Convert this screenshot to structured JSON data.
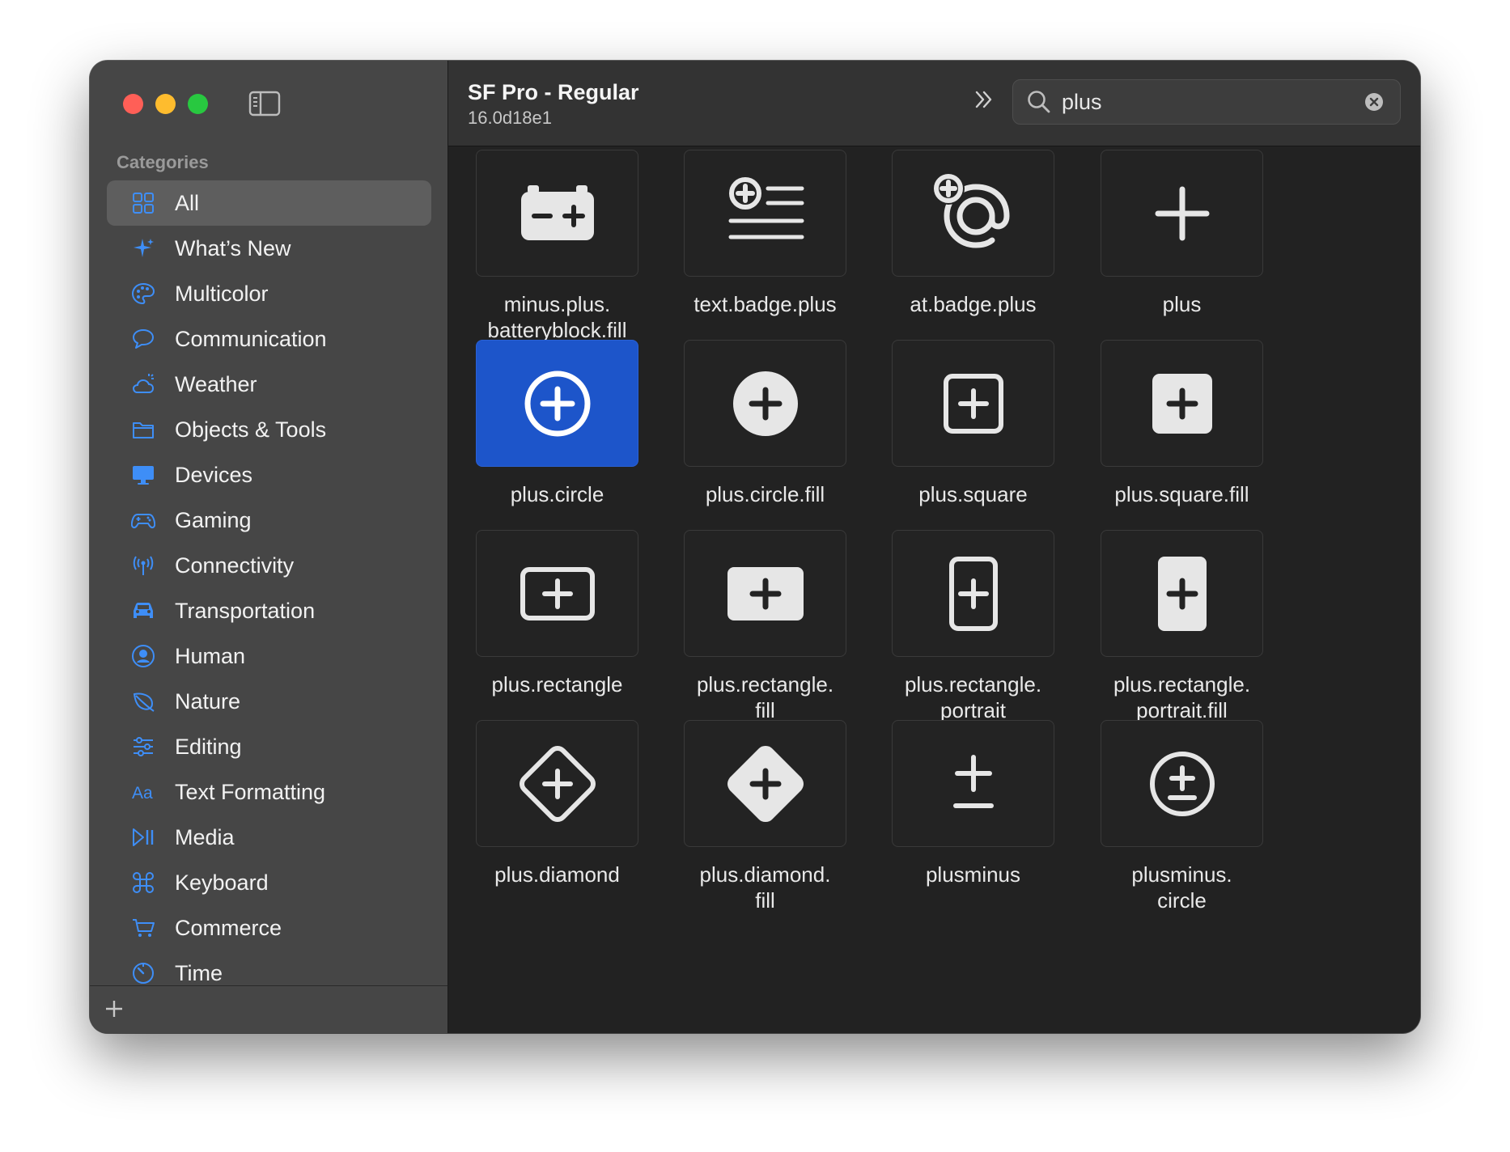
{
  "sidebar": {
    "section_header": "Categories",
    "items": [
      {
        "label": "All",
        "icon": "grid-icon",
        "selected": true
      },
      {
        "label": "What’s New",
        "icon": "sparkle-icon"
      },
      {
        "label": "Multicolor",
        "icon": "palette-icon"
      },
      {
        "label": "Communication",
        "icon": "message-bubble-icon"
      },
      {
        "label": "Weather",
        "icon": "cloud-sun-icon"
      },
      {
        "label": "Objects & Tools",
        "icon": "folder-icon"
      },
      {
        "label": "Devices",
        "icon": "desktop-computer-icon"
      },
      {
        "label": "Gaming",
        "icon": "gamecontroller-icon"
      },
      {
        "label": "Connectivity",
        "icon": "antenna-icon"
      },
      {
        "label": "Transportation",
        "icon": "car-icon"
      },
      {
        "label": "Human",
        "icon": "person-circle-icon"
      },
      {
        "label": "Nature",
        "icon": "leaf-icon"
      },
      {
        "label": "Editing",
        "icon": "sliders-icon"
      },
      {
        "label": "Text Formatting",
        "icon": "text-format-icon"
      },
      {
        "label": "Media",
        "icon": "play-pause-icon"
      },
      {
        "label": "Keyboard",
        "icon": "command-icon"
      },
      {
        "label": "Commerce",
        "icon": "cart-icon"
      },
      {
        "label": "Time",
        "icon": "timer-icon"
      }
    ]
  },
  "toolbar": {
    "font_title": "SF Pro - Regular",
    "font_version": "16.0d18e1"
  },
  "search": {
    "value": "plus"
  },
  "symbols": [
    {
      "label": "minus.plus.\nbatteryblock.fill",
      "icon": "minus-plus-batteryblock-fill-icon"
    },
    {
      "label": "text.badge.plus",
      "icon": "text-badge-plus-icon"
    },
    {
      "label": "at.badge.plus",
      "icon": "at-badge-plus-icon"
    },
    {
      "label": "plus",
      "icon": "plus-icon"
    },
    {
      "label": "plus.circle",
      "icon": "plus-circle-icon",
      "selected": true
    },
    {
      "label": "plus.circle.fill",
      "icon": "plus-circle-fill-icon"
    },
    {
      "label": "plus.square",
      "icon": "plus-square-icon"
    },
    {
      "label": "plus.square.fill",
      "icon": "plus-square-fill-icon"
    },
    {
      "label": "plus.rectangle",
      "icon": "plus-rectangle-icon"
    },
    {
      "label": "plus.rectangle.\nfill",
      "icon": "plus-rectangle-fill-icon"
    },
    {
      "label": "plus.rectangle.\nportrait",
      "icon": "plus-rectangle-portrait-icon"
    },
    {
      "label": "plus.rectangle.\nportrait.fill",
      "icon": "plus-rectangle-portrait-fill-icon"
    },
    {
      "label": "plus.diamond",
      "icon": "plus-diamond-icon"
    },
    {
      "label": "plus.diamond.\nfill",
      "icon": "plus-diamond-fill-icon"
    },
    {
      "label": "plusminus",
      "icon": "plusminus-icon"
    },
    {
      "label": "plusminus.\ncircle",
      "icon": "plusminus-circle-icon"
    }
  ],
  "colors": {
    "accent": "#1d55ca",
    "sidebar_icon": "#3e8ef7",
    "glyph": "#e6e6e6"
  }
}
